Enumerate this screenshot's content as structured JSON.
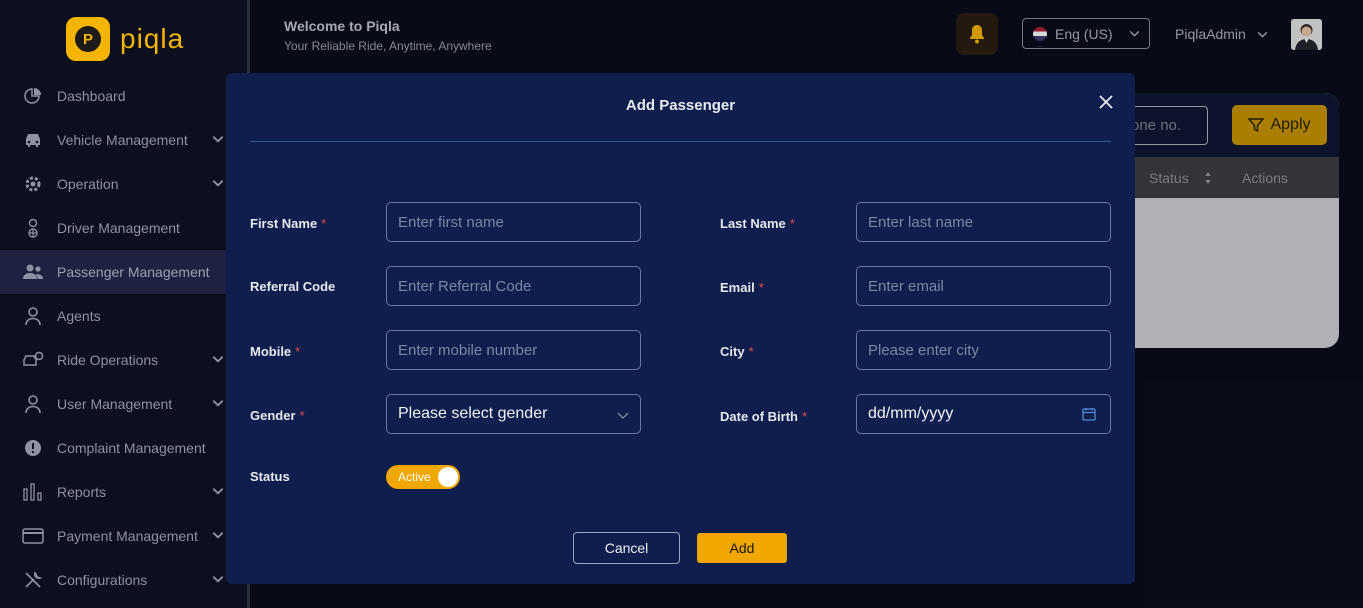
{
  "brand": {
    "logo_letter": "P",
    "name": "piqla"
  },
  "sidebar": {
    "items": [
      {
        "label": "Dashboard",
        "icon": "pie-chart-icon",
        "chevron": false
      },
      {
        "label": "Vehicle Management",
        "icon": "car-icon",
        "chevron": true
      },
      {
        "label": "Operation",
        "icon": "gear-icon",
        "chevron": true
      },
      {
        "label": "Driver Management",
        "icon": "driver-icon",
        "chevron": false
      },
      {
        "label": "Passenger Management",
        "icon": "users-icon",
        "chevron": false,
        "active": true
      },
      {
        "label": "Agents",
        "icon": "person-icon",
        "chevron": false
      },
      {
        "label": "Ride Operations",
        "icon": "car-gear-icon",
        "chevron": true
      },
      {
        "label": "User Management",
        "icon": "person-icon",
        "chevron": true
      },
      {
        "label": "Complaint Management",
        "icon": "alert-icon",
        "chevron": false
      },
      {
        "label": "Reports",
        "icon": "bar-chart-icon",
        "chevron": true
      },
      {
        "label": "Payment Management",
        "icon": "card-icon",
        "chevron": true
      },
      {
        "label": "Configurations",
        "icon": "tools-icon",
        "chevron": true
      }
    ]
  },
  "header": {
    "title": "Welcome to Piqla",
    "subtitle": "Your Reliable Ride, Anytime, Anywhere",
    "language": "Eng (US)",
    "username": "PiqlaAdmin"
  },
  "background": {
    "search_placeholder": "one no.",
    "apply_label": "Apply",
    "columns": [
      "Status",
      "Actions"
    ]
  },
  "modal": {
    "title": "Add Passenger",
    "fields": {
      "first_name": {
        "label": "First Name",
        "required": "*",
        "placeholder": "Enter first name"
      },
      "last_name": {
        "label": "Last Name",
        "required": "*",
        "placeholder": "Enter last name"
      },
      "referral": {
        "label": "Referral Code",
        "placeholder": "Enter Referral Code"
      },
      "email": {
        "label": "Email",
        "required": "*",
        "placeholder": "Enter email"
      },
      "mobile": {
        "label": "Mobile",
        "required": "*",
        "placeholder": "Enter mobile number"
      },
      "city": {
        "label": "City",
        "required": "*",
        "placeholder": "Please enter city"
      },
      "gender": {
        "label": "Gender",
        "required": "*",
        "value": "Please select gender"
      },
      "dob": {
        "label": "Date of Birth",
        "required": "*",
        "value": "dd/mm/yyyy"
      },
      "status": {
        "label": "Status",
        "value": "Active"
      }
    },
    "cancel_label": "Cancel",
    "add_label": "Add"
  },
  "colors": {
    "accent": "#f0a800",
    "modal_bg": "#101e4d",
    "required": "#e34b4b"
  }
}
